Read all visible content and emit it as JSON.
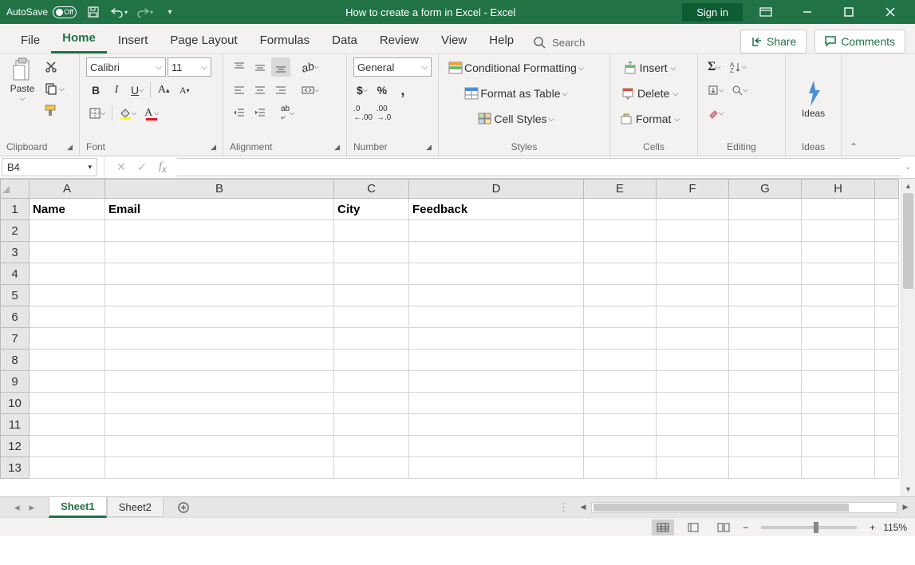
{
  "titlebar": {
    "autosave_label": "AutoSave",
    "autosave_state": "Off",
    "document_title": "How to create a form in Excel  -  Excel",
    "signin": "Sign in"
  },
  "menu": {
    "tabs": [
      "File",
      "Home",
      "Insert",
      "Page Layout",
      "Formulas",
      "Data",
      "Review",
      "View",
      "Help"
    ],
    "search": "Search",
    "share": "Share",
    "comments": "Comments"
  },
  "ribbon": {
    "clipboard": {
      "paste": "Paste",
      "label": "Clipboard"
    },
    "font": {
      "name": "Calibri",
      "size": "11",
      "label": "Font"
    },
    "alignment": {
      "label": "Alignment"
    },
    "number": {
      "format": "General",
      "label": "Number"
    },
    "styles": {
      "conditional": "Conditional Formatting",
      "table": "Format as Table",
      "cellstyles": "Cell Styles",
      "label": "Styles"
    },
    "cells": {
      "insert": "Insert",
      "delete": "Delete",
      "format": "Format",
      "label": "Cells"
    },
    "editing": {
      "label": "Editing"
    },
    "ideas": {
      "label": "Ideas",
      "btn": "Ideas"
    }
  },
  "formula": {
    "namebox": "B4",
    "value": ""
  },
  "columns": [
    "A",
    "B",
    "C",
    "D",
    "E",
    "F",
    "G",
    "H",
    ""
  ],
  "rows": [
    "1",
    "2",
    "3",
    "4",
    "5",
    "6",
    "7",
    "8",
    "9",
    "10",
    "11",
    "12",
    "13"
  ],
  "cells": {
    "A1": "Name",
    "B1": "Email",
    "C1": "City",
    "D1": "Feedback"
  },
  "sheets": {
    "tabs": [
      "Sheet1",
      "Sheet2"
    ],
    "active": 0
  },
  "status": {
    "zoom": "115%"
  }
}
